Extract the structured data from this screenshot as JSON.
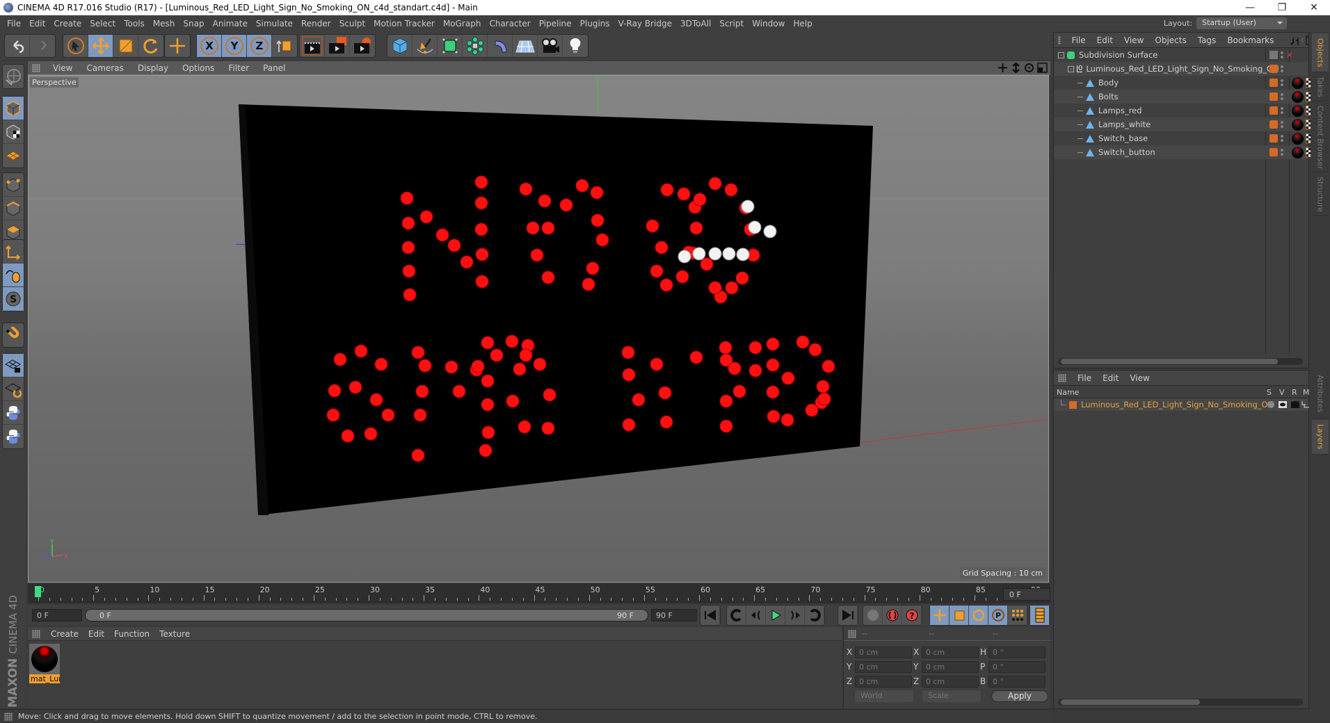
{
  "window": {
    "title": "CINEMA 4D R17.016 Studio (R17) - [Luminous_Red_LED_Light_Sign_No_Smoking_ON_c4d_standart.c4d] - Main",
    "controls": [
      "minimize",
      "restore",
      "close"
    ]
  },
  "menubar": {
    "items": [
      "File",
      "Edit",
      "Create",
      "Select",
      "Tools",
      "Mesh",
      "Snap",
      "Animate",
      "Simulate",
      "Render",
      "Sculpt",
      "Motion Tracker",
      "MoGraph",
      "Character",
      "Pipeline",
      "Plugins",
      "V-Ray Bridge",
      "3DToAll",
      "Script",
      "Window",
      "Help"
    ],
    "layout_label": "Layout:",
    "layout_value": "Startup (User)"
  },
  "toolbar": {
    "groups": [
      [
        "undo-icon",
        "redo-icon"
      ],
      [
        "select-arrow-icon",
        "move-icon",
        "scale-icon",
        "rotate-icon"
      ],
      [
        "live-selection-icon"
      ],
      [
        "x-axis-icon",
        "y-axis-icon",
        "z-axis-icon",
        "coordinate-system-icon"
      ],
      [
        "render-view-icon",
        "render-picture-viewer-icon",
        "render-settings-icon"
      ],
      [
        "cube-icon",
        "pen-icon",
        "subdivision-icon",
        "cloner-icon",
        "deformer-icon",
        "floor-icon",
        "camera-icon",
        "light-icon"
      ]
    ]
  },
  "left_tools": [
    "make-editable-icon",
    "model-mode-icon",
    "texture-mode-icon",
    "workplane-icon",
    "points-mode-icon",
    "edges-mode-icon",
    "polygons-mode-icon",
    "axis-icon",
    "tweak-icon",
    "solo-icon",
    "snap-icon",
    "workplane-lock-icon",
    "workplane-align-icon",
    "python-icon",
    "python-icon-2"
  ],
  "viewport": {
    "menu": [
      "View",
      "Cameras",
      "Display",
      "Options",
      "Filter",
      "Panel"
    ],
    "camera_label": "Perspective",
    "grid_spacing": "Grid Spacing : 10 cm",
    "nav_icons": [
      "move-view-icon",
      "zoom-view-icon",
      "rotate-view-icon",
      "maximize-view-icon"
    ],
    "axis_labels": {
      "x": "X",
      "y": "Y",
      "z": "Z"
    },
    "scene": {
      "object": "LED sign reading NO SMOKING with cigarette symbol",
      "lamp_red": "#ff1010",
      "lamp_white": "#f2f2f2",
      "panel_color": "#000000"
    }
  },
  "timeline": {
    "ticks": [
      "0",
      "5",
      "10",
      "15",
      "20",
      "25",
      "30",
      "35",
      "40",
      "45",
      "50",
      "55",
      "60",
      "65",
      "70",
      "75",
      "80",
      "85",
      "90"
    ],
    "current_frame_end": "0 F",
    "start_field": "0 F",
    "range_start": "0 F",
    "range_end": "90 F",
    "end_field": "90 F",
    "playback_icons": [
      "goto-start-icon",
      "prev-key-icon",
      "prev-frame-icon",
      "play-icon",
      "next-frame-icon",
      "next-key-icon",
      "goto-end-icon"
    ],
    "record_icons": [
      "keyframe-disabled-icon",
      "autokey-icon",
      "help-key-icon"
    ],
    "key_icons": [
      "key-position-icon",
      "key-scale-icon",
      "key-rotation-icon",
      "key-param-icon",
      "key-pla-icon",
      "timeline-icon"
    ]
  },
  "material_manager": {
    "menu": [
      "Create",
      "Edit",
      "Function",
      "Texture"
    ],
    "materials": [
      {
        "name": "mat_Lun"
      }
    ],
    "brand_top": "MAXON",
    "brand_bottom": "CINEMA 4D"
  },
  "coordinates": {
    "headers": [
      "--",
      "--",
      "--"
    ],
    "rows": [
      {
        "l1": "X",
        "v1": "0 cm",
        "l2": "X",
        "v2": "0 cm",
        "l3": "H",
        "v3": "0 °"
      },
      {
        "l1": "Y",
        "v1": "0 cm",
        "l2": "Y",
        "v2": "0 cm",
        "l3": "P",
        "v3": "0 °"
      },
      {
        "l1": "Z",
        "v1": "0 cm",
        "l2": "Z",
        "v2": "0 cm",
        "l3": "B",
        "v3": "0 °"
      }
    ],
    "mode1": "World",
    "mode2": "Scale",
    "apply": "Apply"
  },
  "status": {
    "text": "Move: Click and drag to move elements. Hold down SHIFT to quantize movement / add to the selection in point mode, CTRL to remove."
  },
  "object_manager": {
    "menu": [
      "File",
      "Edit",
      "View",
      "Objects",
      "Tags",
      "Bookmarks"
    ],
    "objects": [
      {
        "name": "Subdivision Surface",
        "depth": 0,
        "type": "subdivision"
      },
      {
        "name": "Luminous_Red_LED_Light_Sign_No_Smoking_ON",
        "depth": 1,
        "type": "null"
      },
      {
        "name": "Body",
        "depth": 2,
        "type": "polygon"
      },
      {
        "name": "Bolts",
        "depth": 2,
        "type": "polygon"
      },
      {
        "name": "Lamps_red",
        "depth": 2,
        "type": "polygon"
      },
      {
        "name": "Lamps_white",
        "depth": 2,
        "type": "polygon"
      },
      {
        "name": "Switch_base",
        "depth": 2,
        "type": "polygon"
      },
      {
        "name": "Switch_button",
        "depth": 2,
        "type": "polygon"
      }
    ]
  },
  "layer_manager": {
    "menu": [
      "File",
      "Edit",
      "View"
    ],
    "columns": [
      "Name",
      "S",
      "V",
      "R",
      "M",
      "L"
    ],
    "layers": [
      {
        "name": "Luminous_Red_LED_Light_Sign_No_Smoking_ON",
        "color": "#d66a27"
      }
    ]
  },
  "right_tabs": {
    "top": [
      {
        "label": "Objects",
        "active": true
      },
      {
        "label": "Takes",
        "active": false
      },
      {
        "label": "Content Browser",
        "active": false
      },
      {
        "label": "Structure",
        "active": false
      }
    ],
    "bottom": [
      {
        "label": "Attributes",
        "active": false
      },
      {
        "label": "Layers",
        "active": true
      }
    ]
  },
  "colors": {
    "accent_orange": "#e7a33f",
    "layer_orange": "#d66a27",
    "active_blue": "#7f9ac0",
    "ui_bg": "#3f3f3f",
    "playhead_green": "#3ddc84"
  }
}
